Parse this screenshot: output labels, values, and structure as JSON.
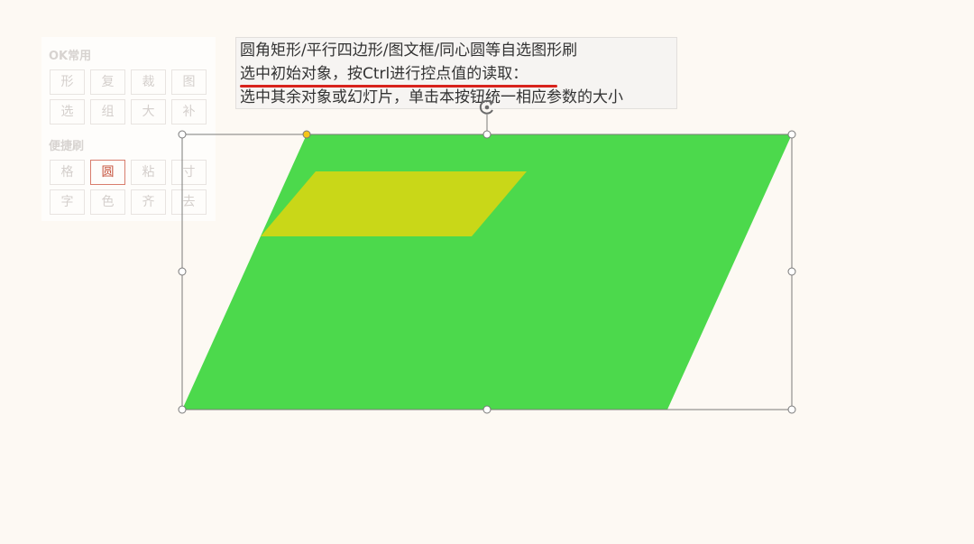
{
  "colors": {
    "background": "#fdf9f3",
    "outer_shape": "#4cd94c",
    "inner_shape": "#c9d718",
    "selection_frame": "#7a7a7a",
    "adjust_handle": "#f5c518",
    "tip_underline": "#d8231c"
  },
  "panel": {
    "section1_title": "OK常用",
    "section1_buttons": [
      "形",
      "复",
      "裁",
      "图",
      "选",
      "组",
      "大",
      "补"
    ],
    "section2_title": "便捷刷",
    "section2_buttons": [
      "格",
      "圆",
      "粘",
      "寸",
      "字",
      "色",
      "齐",
      "去"
    ],
    "active_button": "圆"
  },
  "tip": {
    "line1": "圆角矩形/平行四边形/图文框/同心圆等自选图形刷",
    "line2": "选中初始对象，按Ctrl进行控点值的读取：",
    "line3": "选中其余对象或幻灯片，单击本按钮统一相应参数的大小"
  },
  "canvas": {
    "outer_shape_name": "parallelogram",
    "inner_shape_name": "parallelogram",
    "rotate_icon": "rotate-icon"
  }
}
